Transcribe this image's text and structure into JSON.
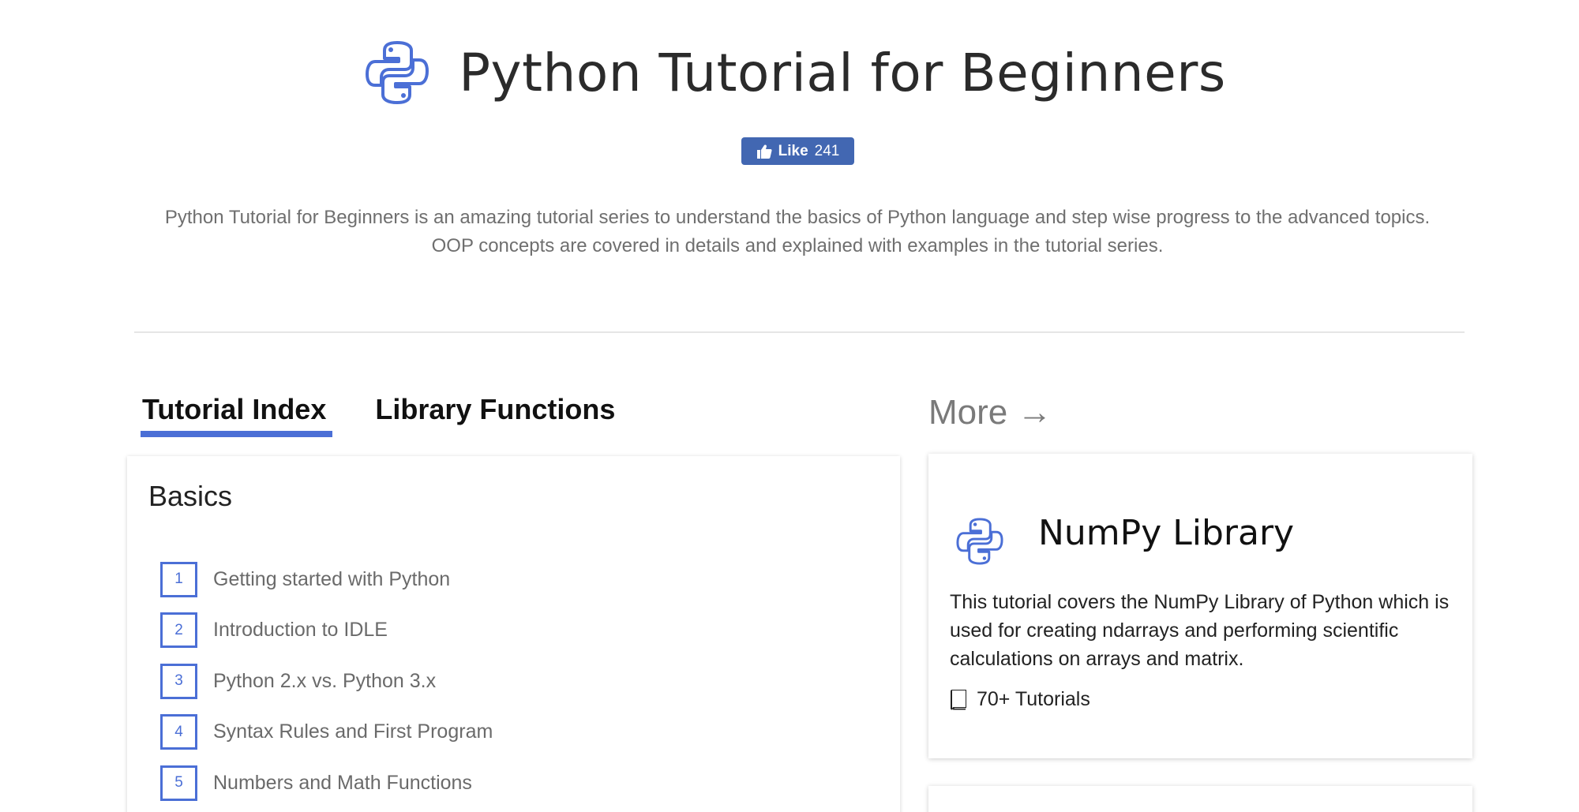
{
  "header": {
    "title": "Python Tutorial for Beginners",
    "like": {
      "label": "Like",
      "count": "241"
    },
    "description_line1": "Python Tutorial for Beginners is an amazing tutorial series to understand the basics of Python language and step wise progress to the advanced topics.",
    "description_line2": "OOP concepts are covered in details and explained with examples in the tutorial series."
  },
  "tabs": [
    {
      "label": "Tutorial Index",
      "active": true
    },
    {
      "label": "Library Functions",
      "active": false
    }
  ],
  "more": {
    "label": "More →"
  },
  "index": {
    "section_title": "Basics",
    "lessons": [
      {
        "num": "1",
        "title": "Getting started with Python"
      },
      {
        "num": "2",
        "title": "Introduction to IDLE"
      },
      {
        "num": "3",
        "title": "Python 2.x vs. Python 3.x"
      },
      {
        "num": "4",
        "title": "Syntax Rules and First Program"
      },
      {
        "num": "5",
        "title": "Numbers and Math Functions"
      }
    ]
  },
  "library_card": {
    "title": "NumPy Library",
    "description": "This tutorial covers the NumPy Library of Python which is used for creating ndarrays and performing scientific calculations on arrays and matrix.",
    "count": "70+ Tutorials"
  },
  "colors": {
    "accent": "#4b6fd6",
    "facebook": "#4267b2",
    "muted_text": "#6f6f6f"
  }
}
